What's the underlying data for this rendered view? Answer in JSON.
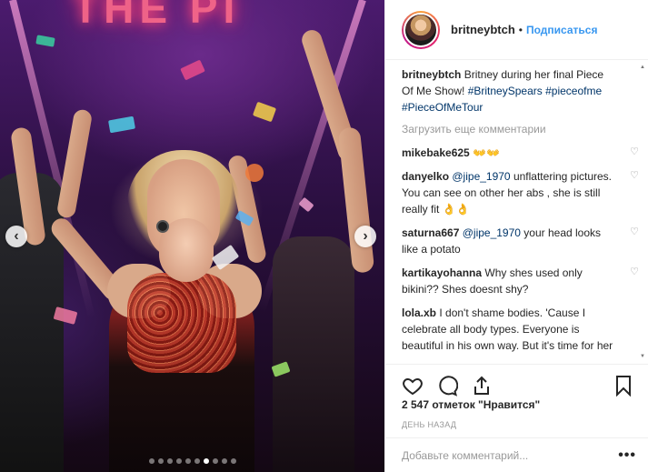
{
  "photo": {
    "slide_count": 10,
    "active_slide": 6,
    "sign_text": "THE PI"
  },
  "header": {
    "username": "britneybtch",
    "separator": "•",
    "follow_label": "Подписаться"
  },
  "caption": {
    "author": "britneybtch",
    "text": "Britney during her final Piece Of Me Show!",
    "tags": [
      "#BritneySpears",
      "#pieceofme",
      "#PieceOfMeTour"
    ]
  },
  "load_more_label": "Загрузить еще комментарии",
  "comments": [
    {
      "author": "mikebake625",
      "text": "👐👐"
    },
    {
      "author": "danyelko",
      "mention": "@jipe_1970",
      "text": "unflattering pictures. You can see on other her abs , she is still really fit 👌👌"
    },
    {
      "author": "saturna667",
      "mention": "@jipe_1970",
      "text": "your head looks like a potato"
    },
    {
      "author": "kartikayohanna",
      "text": "Why shes used only bikini?? Shes doesnt shy?"
    },
    {
      "author": "lola.xb",
      "text": "I don't shame bodies. 'Cause I celebrate all body types. Everyone is beautiful in his own way. But it's time for her to step it up a lil' bit. She needs to start dressing for her body type & her age. Hire a new glam squad. She is"
    }
  ],
  "likes_text": "2 547 отметок \"Нравится\"",
  "time_text": "ДЕНЬ НАЗАД",
  "add_comment_placeholder": "Добавьте комментарий...",
  "more_label": "•••",
  "icons": {
    "heart": "heart-icon",
    "comment": "comment-icon",
    "share": "share-icon",
    "bookmark": "bookmark-icon",
    "prev": "chevron-left-icon",
    "next": "chevron-right-icon"
  },
  "colors": {
    "link": "#003569",
    "follow": "#3897f0",
    "muted": "#999999"
  }
}
